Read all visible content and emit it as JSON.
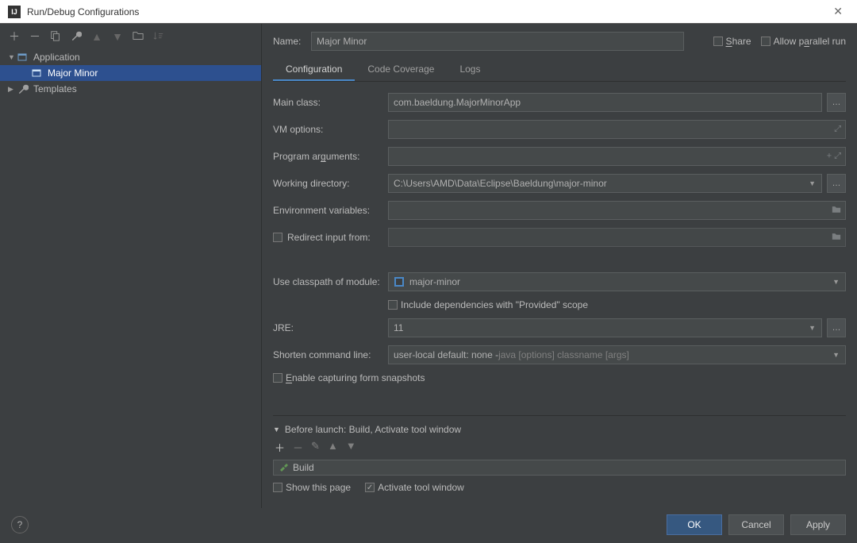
{
  "window": {
    "title": "Run/Debug Configurations"
  },
  "left_panel": {
    "tree": {
      "application": "Application",
      "selected_config": "Major Minor",
      "templates": "Templates"
    }
  },
  "header": {
    "name_label": "Name:",
    "name_value": "Major Minor",
    "share_label": "Share",
    "allow_parallel_label": "Allow parallel run"
  },
  "tabs": {
    "configuration": "Configuration",
    "code_coverage": "Code Coverage",
    "logs": "Logs"
  },
  "form": {
    "main_class_label": "Main class:",
    "main_class_value": "com.baeldung.MajorMinorApp",
    "vm_options_label": "VM options:",
    "vm_options_value": "",
    "program_args_label": "Program arguments:",
    "program_args_value": "",
    "working_dir_label": "Working directory:",
    "working_dir_value": "C:\\Users\\AMD\\Data\\Eclipse\\Baeldung\\major-minor",
    "env_vars_label": "Environment variables:",
    "env_vars_value": "",
    "redirect_input_label": "Redirect input from:",
    "redirect_input_value": "",
    "classpath_label": "Use classpath of module:",
    "classpath_value": "major-minor",
    "include_provided_label": "Include dependencies with \"Provided\" scope",
    "jre_label": "JRE:",
    "jre_value": "11",
    "shorten_label": "Shorten command line:",
    "shorten_value_prefix": "user-local default: none - ",
    "shorten_value_hint": "java [options] classname [args]",
    "enable_snapshots_label": "Enable capturing form snapshots"
  },
  "before_launch": {
    "header": "Before launch: Build, Activate tool window",
    "build_item": "Build",
    "show_page_label": "Show this page",
    "activate_tool_label": "Activate tool window"
  },
  "buttons": {
    "ok": "OK",
    "cancel": "Cancel",
    "apply": "Apply"
  }
}
